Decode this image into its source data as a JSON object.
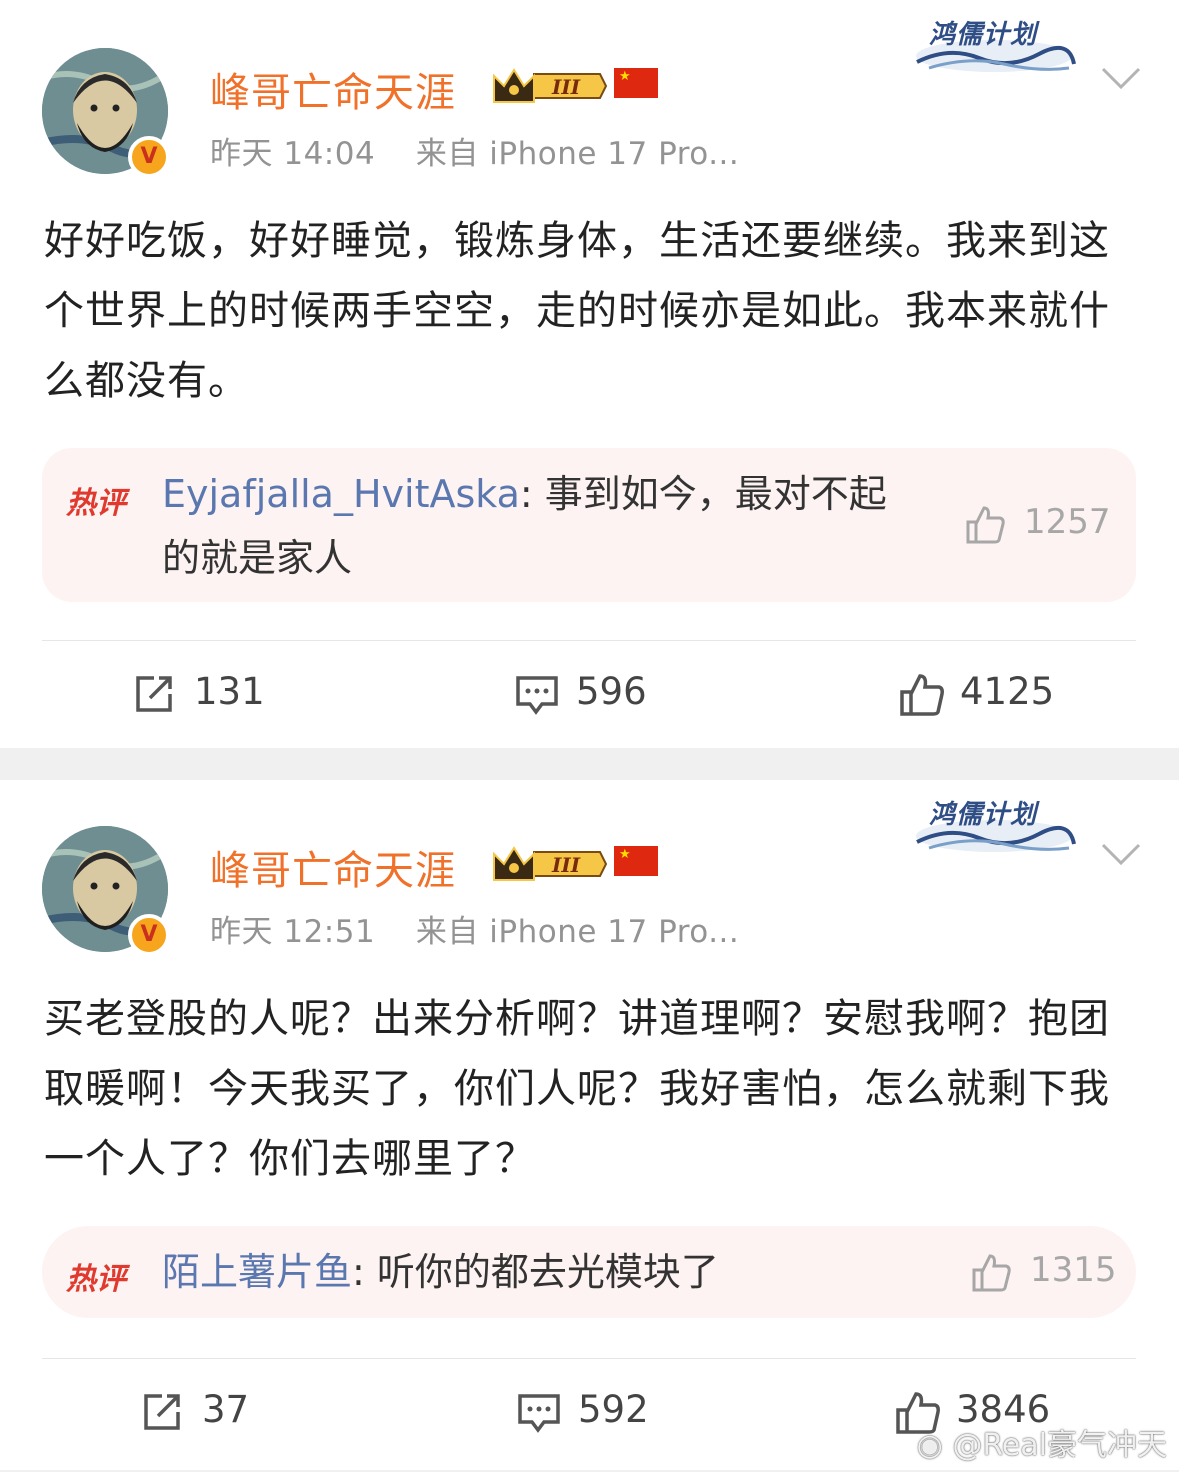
{
  "posts": [
    {
      "badge": "鸿儒计划",
      "username": "峰哥亡命天涯",
      "crown_level": "III",
      "time": "昨天 14:04",
      "source": "来自 iPhone 17 Pro...",
      "content": "好好吃饭，好好睡觉，锻炼身体，生活还要继续。我来到这个世界上的时候两手空空，走的时候亦是如此。我本来就什么都没有。",
      "hot_comment": {
        "tag": "热评",
        "user": "Eyjafjalla_HvitAska",
        "text": ": 事到如今，最对不起的就是家人",
        "likes": "1257"
      },
      "reposts": "131",
      "comments": "596",
      "likes": "4125"
    },
    {
      "badge": "鸿儒计划",
      "username": "峰哥亡命天涯",
      "crown_level": "III",
      "time": "昨天 12:51",
      "source": "来自 iPhone 17 Pro...",
      "content": "买老登股的人呢？出来分析啊？讲道理啊？安慰我啊？抱团取暖啊！今天我买了，你们人呢？我好害怕，怎么就剩下我一个人了？你们去哪里了？",
      "hot_comment": {
        "tag": "热评",
        "user": "陌上薯片鱼",
        "text": ": 听你的都去光模块了",
        "likes": "1315"
      },
      "reposts": "37",
      "comments": "592",
      "likes": "3846"
    }
  ],
  "watermark": "@Real豪气冲天",
  "icons": [
    "repost-icon",
    "comment-icon",
    "like-icon",
    "chevron-down-icon",
    "verified-icon",
    "crown-icon",
    "china-flag-icon"
  ],
  "colors": {
    "username": "#f0712a",
    "hot_user": "#5a77b0",
    "hot_bg": "#fdf3f2",
    "hot_tag": "#e03a2f",
    "meta": "#939393"
  }
}
